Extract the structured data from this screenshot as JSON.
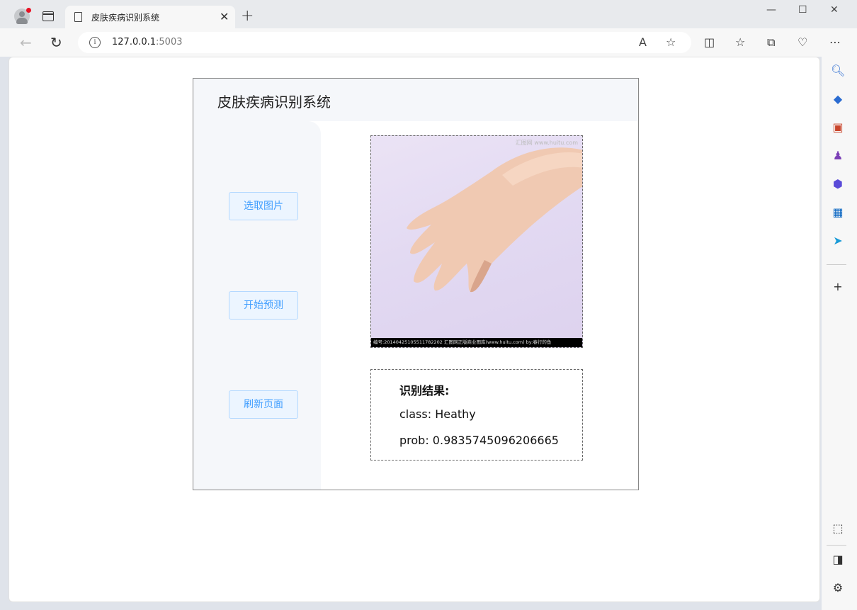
{
  "browser": {
    "tab_title": "皮肤疾病识别系统",
    "tab_close": "✕",
    "new_tab": "+",
    "url_host": "127.0.0.1",
    "url_port": ":5003",
    "window_controls": [
      "—",
      "☐",
      "✕"
    ],
    "info_glyph": "i"
  },
  "app": {
    "title": "皮肤疾病识别系统",
    "buttons": {
      "select_image": "选取图片",
      "start_predict": "开始预测",
      "refresh_page": "刷新页面"
    },
    "image": {
      "watermark": "汇图网 www.huitu.com",
      "caption": "编号:20140425105511782202 汇图网正版商业图库(www.huitu.com) by:春行的鱼"
    },
    "result": {
      "heading": "识别结果:",
      "class_line": "class: Heathy",
      "prob_line": "prob: 0.9835745096206665"
    }
  },
  "icons": {
    "reload": "reload-icon",
    "back": "back-arrow-icon",
    "read_aloud": "read-aloud-icon",
    "favorite": "star-icon",
    "split": "split-screen-icon",
    "favorites": "favorites-icon",
    "collections": "collections-icon",
    "health": "browser-essentials-icon",
    "more": "more-icon"
  }
}
